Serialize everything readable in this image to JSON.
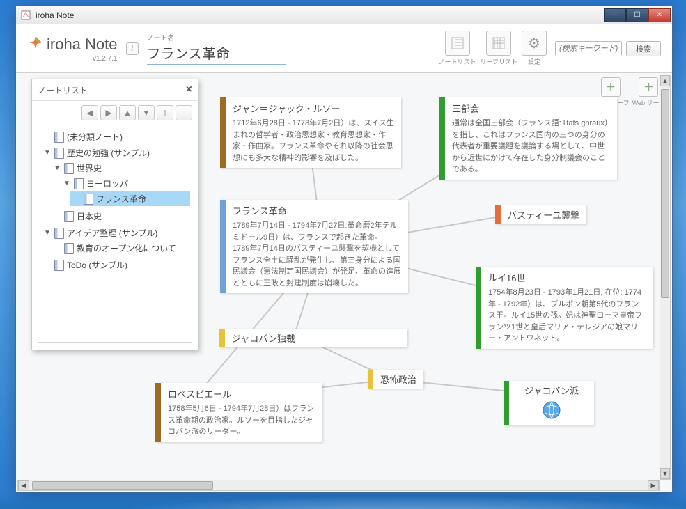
{
  "window": {
    "title": "iroha Note"
  },
  "header": {
    "logo_text": "iroha Note",
    "version": "v1.2.7.1",
    "note_label": "ノート名",
    "note_title": "フランス革命",
    "tools": {
      "notelist": "ノートリスト",
      "leaflist": "リーフリスト",
      "settings": "設定"
    },
    "search_placeholder": "(検索キーワード)",
    "search_button": "検索",
    "leaf_tools": {
      "card": "カードリーフ",
      "web": "Web リーフ"
    }
  },
  "sidebar": {
    "title": "ノートリスト",
    "buttons": {
      "left": "◀",
      "right": "▶",
      "up": "▲",
      "down": "▼",
      "add": "＋",
      "remove": "－"
    },
    "tree": {
      "0": {
        "label": "(未分類ノート)"
      },
      "1": {
        "label": "歴史の勉強 (サンプル)"
      },
      "1_0": {
        "label": "世界史"
      },
      "1_0_0": {
        "label": "ヨーロッパ"
      },
      "1_0_0_0": {
        "label": "フランス革命"
      },
      "1_1": {
        "label": "日本史"
      },
      "2": {
        "label": "アイデア整理 (サンプル)"
      },
      "2_0": {
        "label": "教育のオープン化について"
      },
      "3": {
        "label": "ToDo (サンプル)"
      }
    }
  },
  "cards": {
    "rousseau": {
      "title": "ジャン＝ジャック・ルソー",
      "body": "1712年6月28日 - 1778年7月2日）は、スイス生まれの哲学者・政治思想家・教育思想家・作家・作曲家。フランス革命やそれ以降の社会思想にも多大な精神的影響を及ぼした。",
      "color": "#9e6b22"
    },
    "sanbukai": {
      "title": "三部会",
      "body": "通常は全国三部会（フランス語: l'tats gnraux）を指し、これはフランス国内の三つの身分の代表者が重要議題を議論する場として、中世から近世にかけて存在した身分制議会のことである。",
      "color": "#2e9e2e"
    },
    "kakumei": {
      "title": "フランス革命",
      "body": "1789年7月14日 - 1794年7月27日:革命暦2年テルミドール9日）は、フランスで起きた革命。\n1789年7月14日のバスティーユ襲撃を契機としてフランス全土に騒乱が発生し、第三身分による国民議会（憲法制定国民議会）が発足、革命の進展とともに王政と封建制度は崩壊した。",
      "color": "#6fa3d6"
    },
    "bastille": {
      "title": "バスティーユ襲撃",
      "color": "#e86d3a"
    },
    "louis": {
      "title": "ルイ16世",
      "body": "1754年8月23日 - 1793年1月21日, 在位: 1774年 - 1792年）は、ブルボン朝第5代のフランス王。ルイ15世の孫。妃は神聖ローマ皇帝フランツ1世と皇后マリア・テレジアの娘マリー・アントワネット。",
      "color": "#2e9e2e"
    },
    "jacobin_dict": {
      "title": "ジャコバン独裁",
      "color": "#e8c33a"
    },
    "robes": {
      "title": "ロベスピエール",
      "body": "1758年5月6日 - 1794年7月28日）はフランス革命期の政治家。ルソーを目指したジャコバン派のリーダー。",
      "color": "#9e6b22"
    },
    "terror": {
      "title": "恐怖政治",
      "color": "#e8c33a"
    },
    "jacobin": {
      "title": "ジャコバン派",
      "color": "#2e9e2e"
    }
  }
}
